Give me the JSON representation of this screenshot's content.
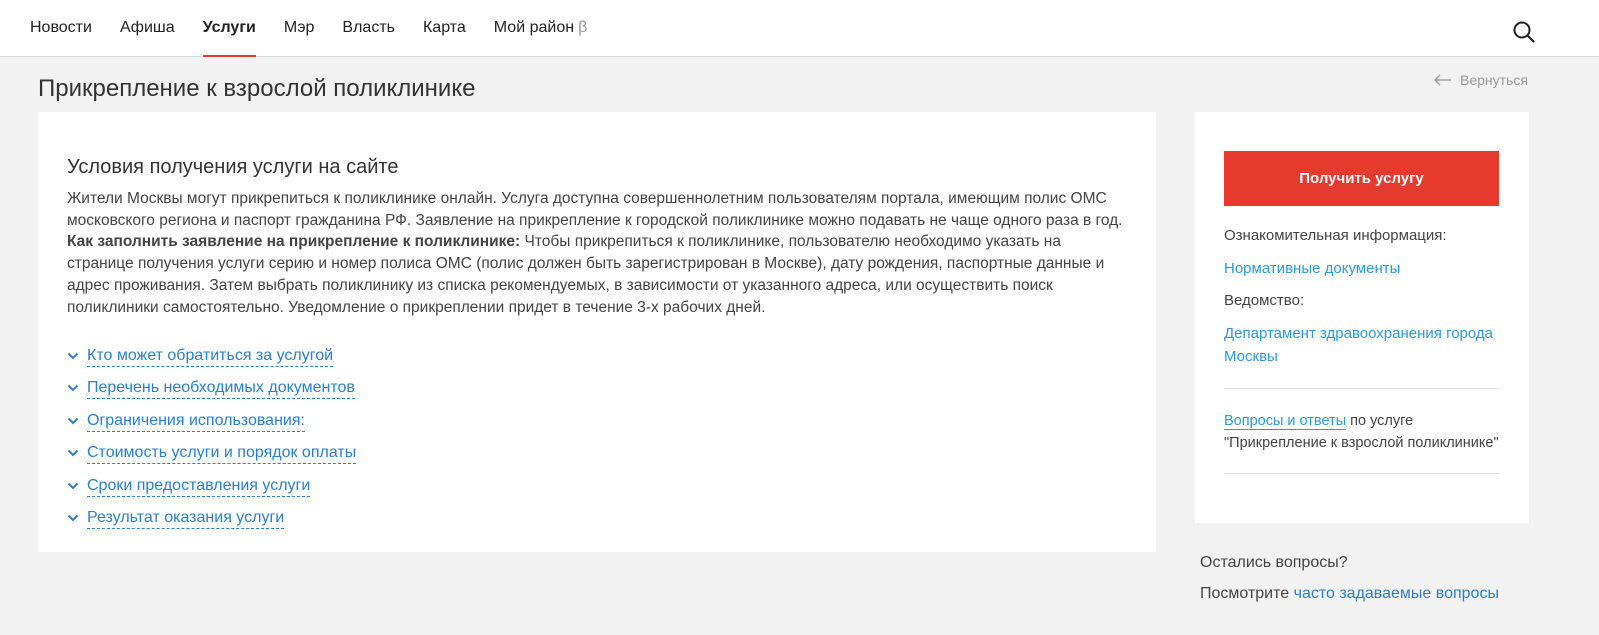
{
  "nav": {
    "items": [
      {
        "label": "Новости"
      },
      {
        "label": "Афиша"
      },
      {
        "label": "Услуги",
        "active": true
      },
      {
        "label": "Мэр"
      },
      {
        "label": "Власть"
      },
      {
        "label": "Карта"
      },
      {
        "label": "Мой район",
        "badge": "β"
      }
    ],
    "search_icon": "search-icon"
  },
  "page": {
    "title": "Прикрепление к взрослой поликлинике",
    "back_label": "Вернуться"
  },
  "main": {
    "section_title": "Условия получения услуги на сайте",
    "paragraph1": "Жители Москвы могут прикрепиться к поликлинике онлайн. Услуга доступна совершеннолетним пользователям портала, имеющим полис ОМС московского региона и паспорт гражданина РФ. Заявление на прикрепление к городской поликлинике можно подавать не чаще одного раза в год.",
    "howto_bold": "Как заполнить заявление на прикрепление к поликлинике:",
    "howto_text": " Чтобы прикрепиться к поликлинике, пользователю необходимо указать на странице получения услуги серию и номер полиса ОМС (полис должен быть зарегистрирован в Москве), дату рождения, паспортные данные и адрес проживания. Затем выбрать поликлинику из списка рекомендуемых, в зависимости от указанного адреса, или осуществить поиск поликлиники самостоятельно. Уведомление о прикреплении придет в течение 3-х рабочих дней.",
    "accordion": [
      {
        "label": "Кто может обратиться за услугой"
      },
      {
        "label": "Перечень необходимых документов"
      },
      {
        "label": "Ограничения использования:"
      },
      {
        "label": "Стоимость услуги и порядок оплаты"
      },
      {
        "label": "Сроки предоставления услуги"
      },
      {
        "label": "Результат оказания услуги"
      }
    ]
  },
  "side": {
    "cta_label": "Получить услугу",
    "info_label": "Ознакомительная информация:",
    "docs_link": "Нормативные документы",
    "dept_label": "Ведомство:",
    "dept_link": "Департамент здравоохранения города Москвы",
    "faq_link": "Вопросы и ответы",
    "faq_suffix": " по услуге",
    "faq_service": "\"Прикрепление к взрослой поликлинике\""
  },
  "help": {
    "question": "Остались вопросы?",
    "prefix": "Посмотрите ",
    "link": "часто задаваемые вопросы"
  },
  "colors": {
    "accent_red": "#e63a2e",
    "link_blue": "#2b7fd0",
    "side_link_blue": "#2b9be0",
    "background": "#f2f2f2"
  }
}
